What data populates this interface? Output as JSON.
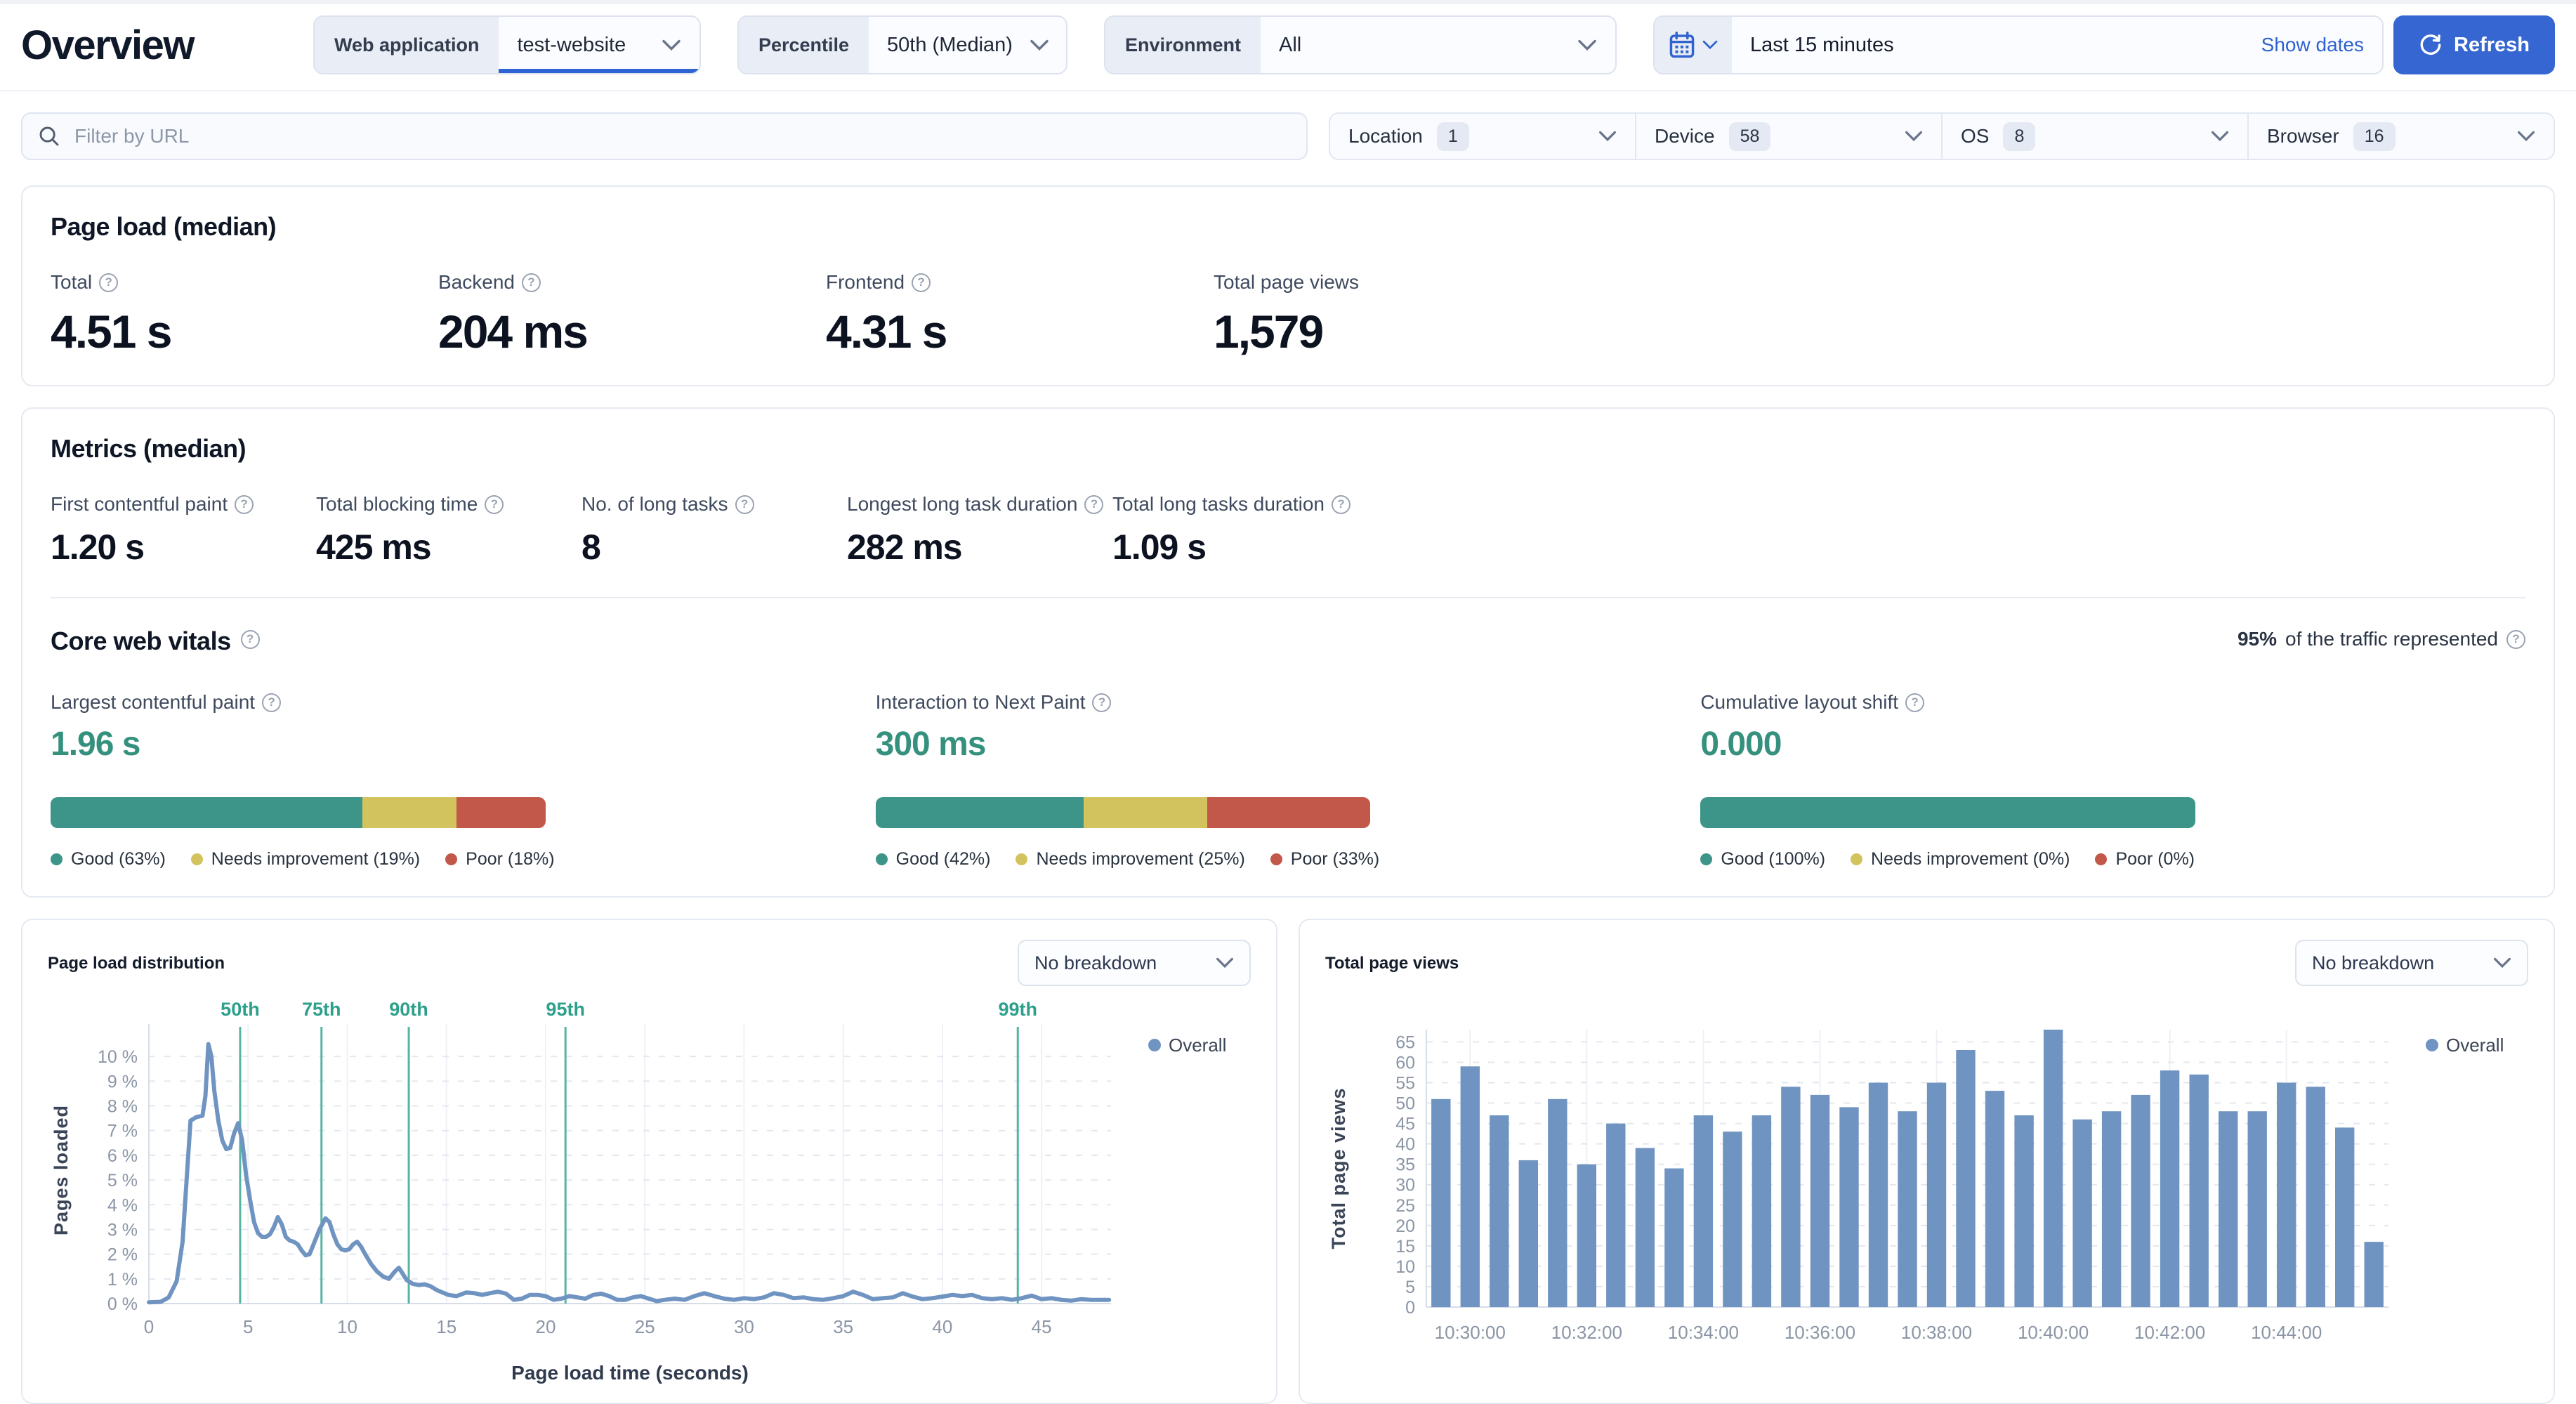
{
  "header": {
    "title": "Overview",
    "web_application": {
      "label": "Web application",
      "value": "test-website"
    },
    "percentile": {
      "label": "Percentile",
      "value": "50th (Median)"
    },
    "environment": {
      "label": "Environment",
      "value": "All"
    },
    "date_picker": {
      "value": "Last 15 minutes",
      "show_dates_label": "Show dates"
    },
    "refresh_label": "Refresh"
  },
  "filters": {
    "url_placeholder": "Filter by URL",
    "groups": [
      {
        "label": "Location",
        "count": "1"
      },
      {
        "label": "Device",
        "count": "58"
      },
      {
        "label": "OS",
        "count": "8"
      },
      {
        "label": "Browser",
        "count": "16"
      }
    ]
  },
  "page_load_card": {
    "title": "Page load (median)",
    "stats": [
      {
        "label": "Total",
        "value": "4.51 s",
        "help": true
      },
      {
        "label": "Backend",
        "value": "204 ms",
        "help": true
      },
      {
        "label": "Frontend",
        "value": "4.31 s",
        "help": true
      },
      {
        "label": "Total page views",
        "value": "1,579",
        "help": false
      }
    ]
  },
  "metrics_card": {
    "title": "Metrics (median)",
    "stats": [
      {
        "label": "First contentful paint",
        "value": "1.20 s",
        "help": true
      },
      {
        "label": "Total blocking time",
        "value": "425 ms",
        "help": true
      },
      {
        "label": "No. of long tasks",
        "value": "8",
        "help": true
      },
      {
        "label": "Longest long task duration",
        "value": "282 ms",
        "help": true
      },
      {
        "label": "Total long tasks duration",
        "value": "1.09 s",
        "help": true
      }
    ]
  },
  "core_web_vitals": {
    "title": "Core web vitals",
    "traffic_note_pct": "95%",
    "traffic_note_text": "of the traffic represented",
    "colors": {
      "good": "#3d9488",
      "needs_improvement": "#d3c35f",
      "poor": "#c2584a"
    },
    "items": [
      {
        "label": "Largest contentful paint",
        "value": "1.96 s",
        "segments": {
          "good": 63,
          "needs_improvement": 19,
          "poor": 18
        },
        "legend": [
          "Good (63%)",
          "Needs improvement (19%)",
          "Poor (18%)"
        ]
      },
      {
        "label": "Interaction to Next Paint",
        "value": "300 ms",
        "segments": {
          "good": 42,
          "needs_improvement": 25,
          "poor": 33
        },
        "legend": [
          "Good (42%)",
          "Needs improvement (25%)",
          "Poor (33%)"
        ]
      },
      {
        "label": "Cumulative layout shift",
        "value": "0.000",
        "segments": {
          "good": 100,
          "needs_improvement": 0,
          "poor": 0
        },
        "legend": [
          "Good (100%)",
          "Needs improvement (0%)",
          "Poor (0%)"
        ]
      }
    ]
  },
  "distribution_card": {
    "title": "Page load distribution",
    "breakdown": "No breakdown",
    "legend": "Overall"
  },
  "page_views_card": {
    "title": "Total page views",
    "breakdown": "No breakdown",
    "legend": "Overall"
  },
  "chart_data": [
    {
      "id": "page_load_distribution",
      "type": "line",
      "title": "Page load distribution",
      "xlabel": "Page load time (seconds)",
      "ylabel": "Pages loaded",
      "xlim": [
        0,
        48.5
      ],
      "ylim": [
        0,
        10.8
      ],
      "x_ticks": [
        0,
        5,
        10,
        15,
        20,
        25,
        30,
        35,
        40,
        45
      ],
      "y_ticks": [
        0,
        1,
        2,
        3,
        4,
        5,
        6,
        7,
        8,
        9,
        10
      ],
      "y_tick_suffix": " %",
      "grid": true,
      "legend_position": "top-right",
      "percentile_markers": [
        {
          "label": "50th",
          "x": 4.6
        },
        {
          "label": "75th",
          "x": 8.7
        },
        {
          "label": "90th",
          "x": 13.1
        },
        {
          "label": "95th",
          "x": 21.0
        },
        {
          "label": "99th",
          "x": 43.8
        }
      ],
      "series": [
        {
          "name": "Overall",
          "color": "#7094c1",
          "points": [
            [
              0,
              0.05
            ],
            [
              0.6,
              0.07
            ],
            [
              1,
              0.25
            ],
            [
              1.4,
              0.9
            ],
            [
              1.7,
              2.5
            ],
            [
              1.9,
              5.0
            ],
            [
              2.1,
              7.4
            ],
            [
              2.4,
              7.55
            ],
            [
              2.7,
              7.6
            ],
            [
              2.85,
              8.4
            ],
            [
              3.0,
              10.5
            ],
            [
              3.15,
              10.0
            ],
            [
              3.3,
              8.6
            ],
            [
              3.5,
              7.4
            ],
            [
              3.7,
              6.6
            ],
            [
              3.9,
              6.25
            ],
            [
              4.1,
              6.3
            ],
            [
              4.3,
              6.9
            ],
            [
              4.5,
              7.3
            ],
            [
              4.7,
              6.6
            ],
            [
              4.9,
              5.2
            ],
            [
              5.1,
              4.2
            ],
            [
              5.3,
              3.3
            ],
            [
              5.5,
              2.85
            ],
            [
              5.7,
              2.7
            ],
            [
              5.9,
              2.7
            ],
            [
              6.1,
              2.8
            ],
            [
              6.3,
              3.1
            ],
            [
              6.5,
              3.5
            ],
            [
              6.7,
              3.2
            ],
            [
              6.9,
              2.7
            ],
            [
              7.1,
              2.55
            ],
            [
              7.3,
              2.5
            ],
            [
              7.5,
              2.4
            ],
            [
              7.7,
              2.15
            ],
            [
              7.9,
              1.95
            ],
            [
              8.1,
              2.0
            ],
            [
              8.3,
              2.4
            ],
            [
              8.6,
              3.0
            ],
            [
              8.9,
              3.45
            ],
            [
              9.1,
              3.3
            ],
            [
              9.3,
              2.8
            ],
            [
              9.5,
              2.4
            ],
            [
              9.7,
              2.2
            ],
            [
              9.9,
              2.15
            ],
            [
              10.1,
              2.2
            ],
            [
              10.3,
              2.4
            ],
            [
              10.5,
              2.5
            ],
            [
              10.7,
              2.3
            ],
            [
              10.9,
              2.0
            ],
            [
              11.2,
              1.6
            ],
            [
              11.5,
              1.3
            ],
            [
              11.8,
              1.1
            ],
            [
              12.1,
              1.0
            ],
            [
              12.4,
              1.3
            ],
            [
              12.6,
              1.45
            ],
            [
              12.8,
              1.2
            ],
            [
              13.0,
              0.95
            ],
            [
              13.3,
              0.8
            ],
            [
              13.6,
              0.75
            ],
            [
              13.9,
              0.78
            ],
            [
              14.2,
              0.7
            ],
            [
              14.5,
              0.55
            ],
            [
              14.8,
              0.45
            ],
            [
              15.1,
              0.35
            ],
            [
              15.5,
              0.3
            ],
            [
              16.0,
              0.45
            ],
            [
              16.4,
              0.42
            ],
            [
              16.8,
              0.35
            ],
            [
              17.2,
              0.42
            ],
            [
              17.6,
              0.48
            ],
            [
              18.0,
              0.4
            ],
            [
              18.4,
              0.15
            ],
            [
              18.8,
              0.2
            ],
            [
              19.2,
              0.35
            ],
            [
              19.6,
              0.35
            ],
            [
              20.0,
              0.3
            ],
            [
              20.4,
              0.15
            ],
            [
              20.8,
              0.2
            ],
            [
              21.2,
              0.3
            ],
            [
              21.6,
              0.25
            ],
            [
              22.0,
              0.2
            ],
            [
              22.4,
              0.35
            ],
            [
              22.8,
              0.4
            ],
            [
              23.2,
              0.3
            ],
            [
              23.6,
              0.15
            ],
            [
              24.0,
              0.15
            ],
            [
              24.4,
              0.25
            ],
            [
              24.8,
              0.3
            ],
            [
              25.2,
              0.2
            ],
            [
              25.6,
              0.1
            ],
            [
              26.0,
              0.15
            ],
            [
              26.5,
              0.2
            ],
            [
              27.0,
              0.15
            ],
            [
              27.5,
              0.3
            ],
            [
              28.0,
              0.42
            ],
            [
              28.5,
              0.3
            ],
            [
              29.0,
              0.2
            ],
            [
              29.5,
              0.15
            ],
            [
              30.0,
              0.22
            ],
            [
              30.5,
              0.18
            ],
            [
              31.0,
              0.25
            ],
            [
              31.5,
              0.42
            ],
            [
              32.0,
              0.35
            ],
            [
              32.5,
              0.22
            ],
            [
              33.0,
              0.25
            ],
            [
              33.5,
              0.18
            ],
            [
              34.0,
              0.15
            ],
            [
              34.5,
              0.22
            ],
            [
              35.0,
              0.3
            ],
            [
              35.5,
              0.48
            ],
            [
              36.0,
              0.35
            ],
            [
              36.5,
              0.18
            ],
            [
              37.0,
              0.22
            ],
            [
              37.5,
              0.25
            ],
            [
              38.0,
              0.42
            ],
            [
              38.5,
              0.28
            ],
            [
              39.0,
              0.18
            ],
            [
              39.5,
              0.22
            ],
            [
              40.0,
              0.28
            ],
            [
              40.5,
              0.35
            ],
            [
              41.0,
              0.3
            ],
            [
              41.5,
              0.35
            ],
            [
              42.0,
              0.22
            ],
            [
              42.5,
              0.18
            ],
            [
              43.0,
              0.22
            ],
            [
              43.5,
              0.15
            ],
            [
              44.0,
              0.22
            ],
            [
              44.5,
              0.32
            ],
            [
              45.0,
              0.18
            ],
            [
              45.5,
              0.22
            ],
            [
              46.0,
              0.15
            ],
            [
              46.5,
              0.12
            ],
            [
              47.0,
              0.18
            ],
            [
              47.5,
              0.15
            ],
            [
              48.0,
              0.15
            ],
            [
              48.4,
              0.15
            ]
          ]
        }
      ]
    },
    {
      "id": "total_page_views",
      "type": "bar",
      "title": "Total page views",
      "ylabel": "Total page views",
      "ylim": [
        0,
        68
      ],
      "y_ticks": [
        0,
        5,
        10,
        15,
        20,
        25,
        30,
        35,
        40,
        45,
        50,
        55,
        60,
        65
      ],
      "bar_color": "#7094c1",
      "series_name": "Overall",
      "values": [
        51,
        59,
        47,
        36,
        51,
        35,
        45,
        39,
        34,
        47,
        43,
        47,
        54,
        52,
        49,
        55,
        48,
        55,
        63,
        53,
        47,
        68,
        46,
        48,
        52,
        58,
        57,
        48,
        48,
        55,
        54,
        44,
        16
      ],
      "x_tick_labels": [
        "10:30:00",
        "10:32:00",
        "10:34:00",
        "10:36:00",
        "10:38:00",
        "10:40:00",
        "10:42:00",
        "10:44:00"
      ],
      "x_tick_bar_indices": [
        1,
        5,
        9,
        13,
        17,
        21,
        25,
        29
      ]
    }
  ],
  "ui_colors": {
    "accent_blue": "#3566d1",
    "link_blue": "#2d62cf",
    "series_blue": "#7094c1",
    "percentile_teal": "#56b4a3",
    "vital_teal": "#35917e"
  }
}
